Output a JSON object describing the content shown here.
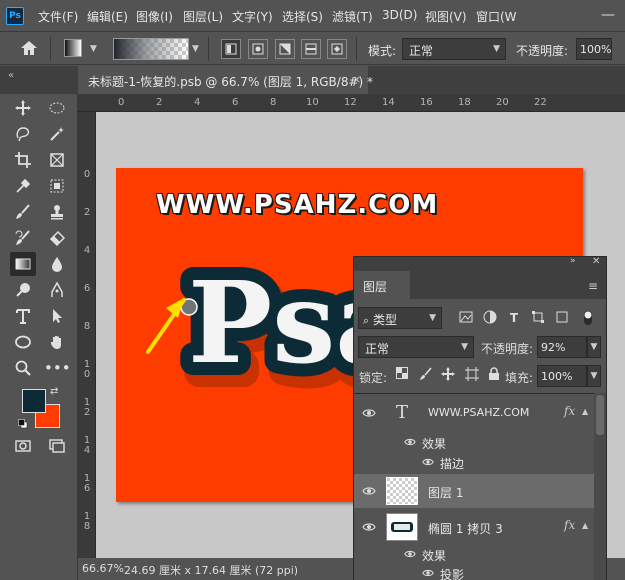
{
  "menubar": {
    "items": [
      "文件(F)",
      "编辑(E)",
      "图像(I)",
      "图层(L)",
      "文字(Y)",
      "选择(S)",
      "滤镜(T)",
      "3D(D)",
      "视图(V)",
      "窗口(W"
    ],
    "logo": "Ps"
  },
  "options": {
    "mode_label": "模式:",
    "mode_value": "正常",
    "opacity_label": "不透明度:",
    "opacity_value": "100%"
  },
  "tabs": {
    "document": "未标题-1-恢复的.psb @ 66.7% (图层 1, RGB/8#) *",
    "close": "×"
  },
  "toolbar": {
    "foreground_color": "#0d2b36",
    "background_color": "#ff3c00"
  },
  "rulers": {
    "top": [
      "0",
      "2",
      "4",
      "6",
      "8",
      "10",
      "12",
      "14",
      "16",
      "18",
      "20",
      "22"
    ],
    "left": [
      "0",
      "2",
      "4",
      "6",
      "8",
      "1",
      "0",
      "1",
      "2",
      "1",
      "4",
      "1",
      "6",
      "1",
      "8"
    ]
  },
  "canvas": {
    "site_text": "WWW.PSAHZ.COM",
    "logo_text": "Psahz",
    "artboard_color": "#ff3c00",
    "arrow_color": "#ffe000"
  },
  "status": {
    "zoom": "66.67%",
    "doc_size": "24.69 厘米 x 17.64 厘米 (72 ppi)"
  },
  "layers_panel": {
    "tab": "图层",
    "filter_value": "类型",
    "blend_mode": "正常",
    "opacity_label": "不透明度:",
    "opacity_value": "92%",
    "lock_label": "锁定:",
    "fill_label": "填充:",
    "fill_value": "100%",
    "layers": [
      {
        "name": "WWW.PSAHZ.COM",
        "type": "text",
        "fx": "fx",
        "effects_label": "效果",
        "effects": [
          "描边"
        ]
      },
      {
        "name": "图层 1",
        "type": "pixel",
        "selected": true
      },
      {
        "name": "椭圆 1 拷贝 3",
        "type": "shape",
        "fx": "fx",
        "effects_label": "效果",
        "effects": [
          "投影"
        ]
      }
    ]
  }
}
